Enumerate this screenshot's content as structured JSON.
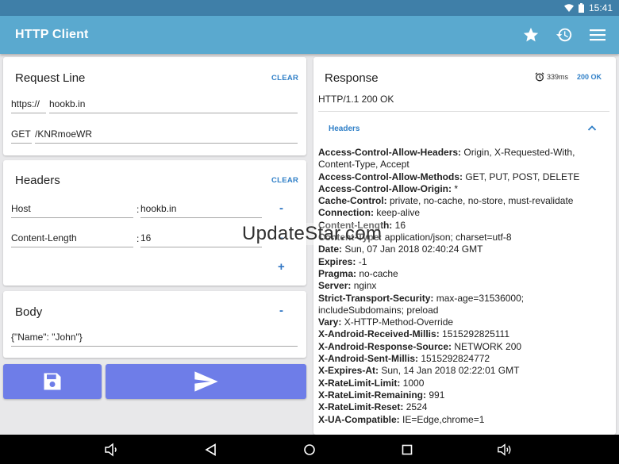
{
  "status_bar": {
    "time": "15:41",
    "icons": [
      "wifi-icon",
      "battery-icon"
    ]
  },
  "app_bar": {
    "title": "HTTP Client",
    "actions": [
      "star-icon",
      "history-icon",
      "menu-icon"
    ]
  },
  "request_line": {
    "title": "Request Line",
    "clear_label": "CLEAR",
    "scheme": "https://",
    "host": "hookb.in",
    "method": "GET",
    "path": "/KNRmoeWR"
  },
  "headers": {
    "title": "Headers",
    "clear_label": "CLEAR",
    "separator": ":",
    "remove_label": "-",
    "add_label": "+",
    "rows": [
      {
        "name": "Host",
        "value": "hookb.in"
      },
      {
        "name": "Content-Length",
        "value": "16"
      }
    ]
  },
  "body": {
    "title": "Body",
    "collapse_label": "-",
    "content": "{\"Name\": \"John\"}"
  },
  "buttons": {
    "save": "save-icon",
    "send": "send-icon"
  },
  "response": {
    "title": "Response",
    "time": "339ms",
    "code": "200 OK",
    "status_line": "HTTP/1.1 200 OK",
    "headers_label": "Headers",
    "header_lines": [
      {
        "key": "Access-Control-Allow-Headers:",
        "value": " Origin, X-Requested-With,"
      },
      {
        "key": "",
        "value": "Content-Type, Accept"
      },
      {
        "key": "Access-Control-Allow-Methods:",
        "value": " GET, PUT, POST, DELETE"
      },
      {
        "key": "Access-Control-Allow-Origin:",
        "value": " *"
      },
      {
        "key": "Cache-Control:",
        "value": " private, no-cache, no-store, must-revalidate"
      },
      {
        "key": "Connection:",
        "value": " keep-alive"
      },
      {
        "key": "Content-Length:",
        "value": " 16"
      },
      {
        "key": "Content-Type:",
        "value": " application/json; charset=utf-8"
      },
      {
        "key": "Date:",
        "value": " Sun, 07 Jan 2018 02:40:24 GMT"
      },
      {
        "key": "Expires:",
        "value": " -1"
      },
      {
        "key": "Pragma:",
        "value": " no-cache"
      },
      {
        "key": "Server:",
        "value": " nginx"
      },
      {
        "key": "Strict-Transport-Security:",
        "value": " max-age=31536000;"
      },
      {
        "key": "",
        "value": "includeSubdomains; preload"
      },
      {
        "key": "Vary:",
        "value": " X-HTTP-Method-Override"
      },
      {
        "key": "X-Android-Received-Millis:",
        "value": " 1515292825111"
      },
      {
        "key": "X-Android-Response-Source:",
        "value": " NETWORK 200"
      },
      {
        "key": "X-Android-Sent-Millis:",
        "value": " 1515292824772"
      },
      {
        "key": "X-Expires-At:",
        "value": " Sun, 14 Jan 2018 02:22:01 GMT"
      },
      {
        "key": "X-RateLimit-Limit:",
        "value": " 1000"
      },
      {
        "key": "X-RateLimit-Remaining:",
        "value": " 991"
      },
      {
        "key": "X-RateLimit-Reset:",
        "value": " 2524"
      },
      {
        "key": "X-UA-Compatible:",
        "value": " IE=Edge,chrome=1"
      }
    ]
  },
  "watermark": "UpdateStar.com",
  "nav_bar": [
    "volume-down-icon",
    "back-icon",
    "home-icon",
    "recents-icon",
    "volume-up-icon"
  ]
}
